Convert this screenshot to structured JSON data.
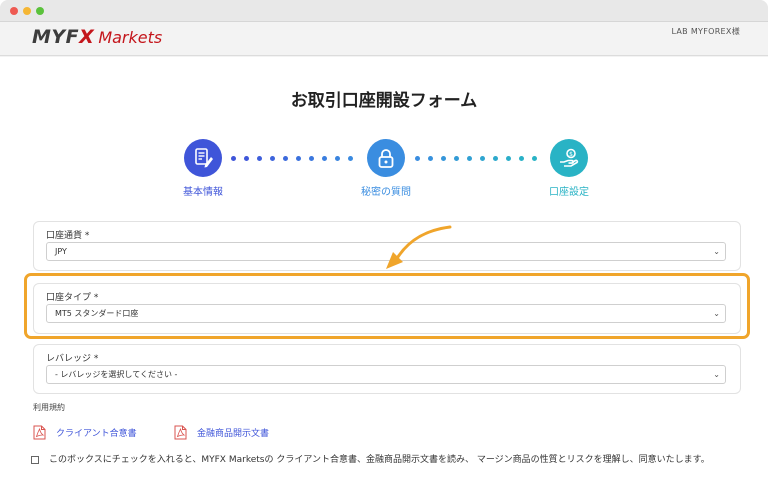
{
  "window": {
    "controls": [
      "close",
      "minimize",
      "maximize"
    ]
  },
  "header": {
    "logo_mark_prefix": "MYF",
    "logo_mark_x": "X",
    "logo_text": "Markets",
    "account_name": "LAB MYFOREX様"
  },
  "page": {
    "title": "お取引口座開設フォーム"
  },
  "steps": [
    {
      "label": "基本情報",
      "icon": "document-edit-icon",
      "color": "#3f55d9"
    },
    {
      "label": "秘密の質問",
      "icon": "lock-icon",
      "color": "#3a8de0"
    },
    {
      "label": "口座設定",
      "icon": "hand-coin-icon",
      "color": "#29b3c5"
    }
  ],
  "fields": {
    "currency": {
      "label": "口座通貨 *",
      "value": "JPY"
    },
    "account_type": {
      "label": "口座タイプ *",
      "value": "MT5 スタンダード口座"
    },
    "leverage": {
      "label": "レバレッジ *",
      "value": "- レバレッジを選択してください -"
    }
  },
  "terms": {
    "title": "利用規約",
    "documents": [
      {
        "label": "クライアント合意書",
        "icon": "pdf-icon"
      },
      {
        "label": "金融商品開示文書",
        "icon": "pdf-icon"
      }
    ],
    "consent_text": "このボックスにチェックを入れると、MYFX Marketsの クライアント合意書、金融商品開示文書を読み、 マージン商品の性質とリスクを理解し、同意いたします。",
    "consent_checked": false
  },
  "colors": {
    "highlight": "#f0a52b",
    "brand_red": "#c4161c",
    "link": "#3f55d9"
  }
}
